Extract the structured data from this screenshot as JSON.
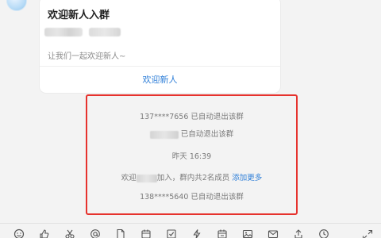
{
  "card": {
    "title": "欢迎新人入群",
    "subtitle": "让我们一起欢迎新人~",
    "action": "欢迎新人"
  },
  "system_messages": [
    {
      "text": "137****7656 已自动退出该群"
    },
    {
      "text": "已自动退出该群"
    },
    {
      "text": "昨天 16:39"
    },
    {
      "prefix": "欢迎",
      "middle": "加入，群内共2名成员 ",
      "link": "添加更多"
    },
    {
      "text": "138****5640 已自动退出该群"
    }
  ],
  "colors": {
    "accent": "#2f7fd8",
    "highlight": "#e6322d"
  },
  "toolbar": {
    "icons": [
      "emoji-icon",
      "thumbs-up-icon",
      "scissors-icon",
      "at-icon",
      "file-icon",
      "calendar-icon",
      "check-icon",
      "lightning-icon",
      "calendar-icon-2",
      "image-icon",
      "mail-icon",
      "share-icon",
      "history-icon"
    ],
    "right_icon": "expand-icon"
  }
}
